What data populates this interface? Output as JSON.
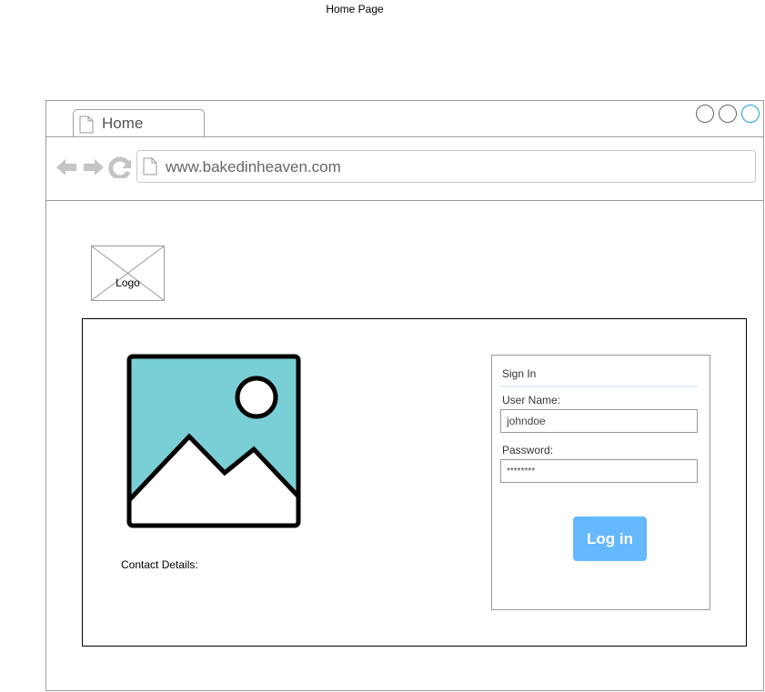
{
  "page_caption": "Home Page",
  "browser": {
    "tab": {
      "label": "Home",
      "icon": "page-icon"
    },
    "window_controls": [
      "circle-button",
      "circle-button",
      "circle-button"
    ],
    "url": "www.bakedinheaven.com",
    "nav_icons": [
      "back-arrow-icon",
      "forward-arrow-icon",
      "reload-icon"
    ]
  },
  "logo": {
    "label": "Logo"
  },
  "hero_image": {
    "icon": "image-placeholder-icon",
    "colors": {
      "sky": "#7acfd6",
      "frame": "#000000"
    }
  },
  "contact": {
    "label": "Contact Details:"
  },
  "signin": {
    "title": "Sign In",
    "username_label": "User Name:",
    "username_value": "johndoe",
    "password_label": "Password:",
    "password_value": "********",
    "login_label": "Log in",
    "colors": {
      "button": "#66b8ff",
      "divider": "#e3eef9"
    }
  }
}
